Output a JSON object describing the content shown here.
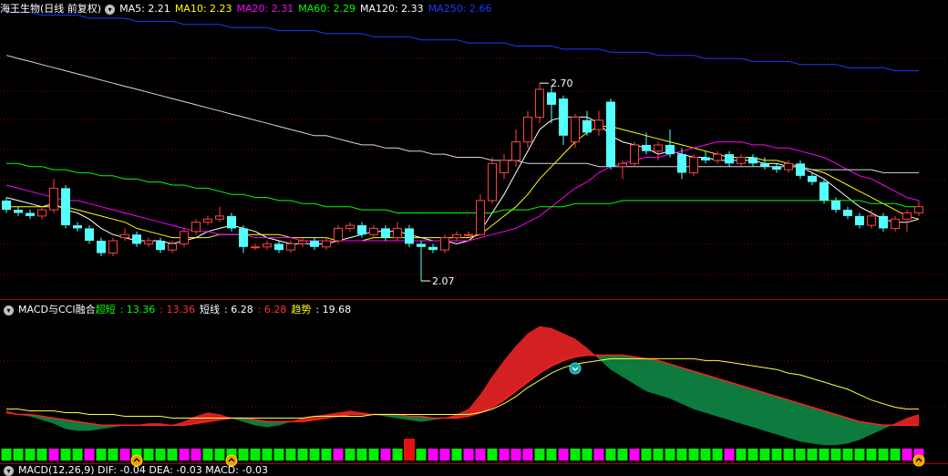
{
  "top_legend": {
    "title": "海王生物(日线 前复权)",
    "items": [
      {
        "label": "MA5: 2.21",
        "color": "#ffffff"
      },
      {
        "label": "MA10: 2.23",
        "color": "#ffff00"
      },
      {
        "label": "MA20: 2.31",
        "color": "#ff00ff"
      },
      {
        "label": "MA60: 2.29",
        "color": "#00ff00"
      },
      {
        "label": "MA120: 2.33",
        "color": "#ffffff"
      },
      {
        "label": "MA250: 2.66",
        "color": "#1e38ff"
      }
    ]
  },
  "price_annotations": {
    "high": "2.70",
    "low": "2.07"
  },
  "mid_legend": {
    "title": "MACD与CCI融合",
    "items": [
      {
        "label": "超短",
        "color": "#00ff00"
      },
      {
        "label": ": 13.36",
        "color": "#00ff00"
      },
      {
        "label": ": 13.36",
        "color": "#ff3030"
      },
      {
        "label": "短线",
        "color": "#ffffff"
      },
      {
        "label": ": 6.28",
        "color": "#ffffff"
      },
      {
        "label": ": 6.28",
        "color": "#ff3030"
      },
      {
        "label": "趋势",
        "color": "#ffff00"
      },
      {
        "label": ": 19.68",
        "color": "#ffffff"
      }
    ]
  },
  "bottom_legend": {
    "text": "MACD(12,26,9) DIF: -0.04 DEA: -0.03 MACD: -0.03"
  },
  "chart_data": {
    "type": "candlestick",
    "ylim": [
      2.02,
      2.92
    ],
    "candles": [
      [
        2.33,
        2.34,
        2.29,
        2.3
      ],
      [
        2.3,
        2.31,
        2.28,
        2.29
      ],
      [
        2.29,
        2.3,
        2.27,
        2.28
      ],
      [
        2.28,
        2.31,
        2.27,
        2.3
      ],
      [
        2.3,
        2.4,
        2.29,
        2.37
      ],
      [
        2.37,
        2.38,
        2.24,
        2.25
      ],
      [
        2.25,
        2.26,
        2.23,
        2.24
      ],
      [
        2.24,
        2.25,
        2.19,
        2.2
      ],
      [
        2.2,
        2.21,
        2.15,
        2.16
      ],
      [
        2.16,
        2.21,
        2.15,
        2.2
      ],
      [
        2.21,
        2.24,
        2.2,
        2.22
      ],
      [
        2.22,
        2.23,
        2.18,
        2.19
      ],
      [
        2.19,
        2.21,
        2.18,
        2.2
      ],
      [
        2.2,
        2.21,
        2.16,
        2.17
      ],
      [
        2.17,
        2.2,
        2.16,
        2.19
      ],
      [
        2.19,
        2.24,
        2.18,
        2.23
      ],
      [
        2.23,
        2.27,
        2.22,
        2.26
      ],
      [
        2.26,
        2.28,
        2.25,
        2.27
      ],
      [
        2.27,
        2.31,
        2.26,
        2.28
      ],
      [
        2.28,
        2.29,
        2.23,
        2.24
      ],
      [
        2.24,
        2.25,
        2.16,
        2.18
      ],
      [
        2.18,
        2.19,
        2.17,
        2.18
      ],
      [
        2.18,
        2.2,
        2.17,
        2.19
      ],
      [
        2.19,
        2.2,
        2.16,
        2.17
      ],
      [
        2.17,
        2.2,
        2.16,
        2.19
      ],
      [
        2.19,
        2.21,
        2.18,
        2.2
      ],
      [
        2.2,
        2.21,
        2.17,
        2.18
      ],
      [
        2.18,
        2.21,
        2.17,
        2.2
      ],
      [
        2.2,
        2.25,
        2.19,
        2.24
      ],
      [
        2.24,
        2.26,
        2.23,
        2.25
      ],
      [
        2.25,
        2.26,
        2.21,
        2.22
      ],
      [
        2.22,
        2.25,
        2.21,
        2.24
      ],
      [
        2.24,
        2.25,
        2.2,
        2.21
      ],
      [
        2.21,
        2.26,
        2.2,
        2.24
      ],
      [
        2.24,
        2.25,
        2.18,
        2.19
      ],
      [
        2.19,
        2.2,
        2.07,
        2.18
      ],
      [
        2.18,
        2.19,
        2.16,
        2.17
      ],
      [
        2.17,
        2.22,
        2.16,
        2.21
      ],
      [
        2.21,
        2.23,
        2.2,
        2.22
      ],
      [
        2.22,
        2.23,
        2.21,
        2.22
      ],
      [
        2.22,
        2.35,
        2.22,
        2.33
      ],
      [
        2.33,
        2.47,
        2.32,
        2.45
      ],
      [
        2.42,
        2.48,
        2.4,
        2.46
      ],
      [
        2.46,
        2.56,
        2.44,
        2.52
      ],
      [
        2.52,
        2.62,
        2.5,
        2.6
      ],
      [
        2.6,
        2.71,
        2.58,
        2.69
      ],
      [
        2.68,
        2.7,
        2.58,
        2.64
      ],
      [
        2.66,
        2.67,
        2.51,
        2.54
      ],
      [
        2.52,
        2.61,
        2.5,
        2.6
      ],
      [
        2.59,
        2.62,
        2.54,
        2.55
      ],
      [
        2.56,
        2.62,
        2.54,
        2.59
      ],
      [
        2.65,
        2.66,
        2.43,
        2.44
      ],
      [
        2.44,
        2.46,
        2.4,
        2.45
      ],
      [
        2.45,
        2.52,
        2.44,
        2.51
      ],
      [
        2.51,
        2.55,
        2.48,
        2.49
      ],
      [
        2.49,
        2.52,
        2.46,
        2.51
      ],
      [
        2.51,
        2.56,
        2.47,
        2.48
      ],
      [
        2.48,
        2.5,
        2.4,
        2.42
      ],
      [
        2.42,
        2.48,
        2.41,
        2.47
      ],
      [
        2.47,
        2.49,
        2.45,
        2.46
      ],
      [
        2.46,
        2.49,
        2.45,
        2.48
      ],
      [
        2.48,
        2.49,
        2.44,
        2.45
      ],
      [
        2.45,
        2.48,
        2.44,
        2.47
      ],
      [
        2.47,
        2.48,
        2.44,
        2.45
      ],
      [
        2.45,
        2.47,
        2.43,
        2.44
      ],
      [
        2.44,
        2.45,
        2.42,
        2.43
      ],
      [
        2.43,
        2.46,
        2.42,
        2.45
      ],
      [
        2.45,
        2.46,
        2.4,
        2.41
      ],
      [
        2.41,
        2.42,
        2.38,
        2.39
      ],
      [
        2.39,
        2.4,
        2.32,
        2.33
      ],
      [
        2.33,
        2.34,
        2.29,
        2.3
      ],
      [
        2.3,
        2.31,
        2.27,
        2.28
      ],
      [
        2.28,
        2.29,
        2.24,
        2.25
      ],
      [
        2.25,
        2.3,
        2.24,
        2.28
      ],
      [
        2.28,
        2.29,
        2.23,
        2.24
      ],
      [
        2.24,
        2.28,
        2.23,
        2.27
      ],
      [
        2.27,
        2.3,
        2.23,
        2.29
      ],
      [
        2.29,
        2.33,
        2.28,
        2.31
      ]
    ],
    "ma": [
      {
        "name": "MA5",
        "color": "#ffffff",
        "values": [
          2.34,
          2.33,
          2.32,
          2.31,
          2.32,
          2.3,
          2.29,
          2.27,
          2.24,
          2.22,
          2.21,
          2.2,
          2.2,
          2.2,
          2.19,
          2.2,
          2.21,
          2.23,
          2.24,
          2.25,
          2.24,
          2.23,
          2.21,
          2.2,
          2.19,
          2.19,
          2.19,
          2.19,
          2.2,
          2.21,
          2.22,
          2.23,
          2.23,
          2.23,
          2.22,
          2.21,
          2.2,
          2.2,
          2.19,
          2.2,
          2.23,
          2.29,
          2.35,
          2.42,
          2.49,
          2.56,
          2.59,
          2.6,
          2.6,
          2.6,
          2.58,
          2.54,
          2.52,
          2.51,
          2.5,
          2.48,
          2.49,
          2.48,
          2.47,
          2.47,
          2.46,
          2.46,
          2.46,
          2.46,
          2.45,
          2.45,
          2.44,
          2.44,
          2.42,
          2.4,
          2.37,
          2.34,
          2.31,
          2.29,
          2.27,
          2.26,
          2.26,
          2.27
        ]
      },
      {
        "name": "MA10",
        "color": "#ffff00",
        "values": [
          2.31,
          2.31,
          2.31,
          2.31,
          2.31,
          2.31,
          2.3,
          2.29,
          2.28,
          2.27,
          2.26,
          2.24,
          2.23,
          2.22,
          2.21,
          2.21,
          2.21,
          2.21,
          2.22,
          2.22,
          2.22,
          2.22,
          2.22,
          2.22,
          2.21,
          2.21,
          2.21,
          2.21,
          2.2,
          2.2,
          2.2,
          2.21,
          2.21,
          2.21,
          2.21,
          2.21,
          2.21,
          2.21,
          2.21,
          2.21,
          2.22,
          2.25,
          2.28,
          2.31,
          2.35,
          2.4,
          2.44,
          2.48,
          2.52,
          2.55,
          2.57,
          2.57,
          2.56,
          2.55,
          2.54,
          2.53,
          2.52,
          2.51,
          2.5,
          2.49,
          2.48,
          2.47,
          2.47,
          2.47,
          2.46,
          2.46,
          2.45,
          2.44,
          2.43,
          2.42,
          2.4,
          2.38,
          2.36,
          2.34,
          2.32,
          2.3,
          2.28,
          2.27
        ]
      },
      {
        "name": "MA20",
        "color": "#ff00ff",
        "values": [
          2.38,
          2.37,
          2.36,
          2.35,
          2.34,
          2.33,
          2.33,
          2.32,
          2.31,
          2.3,
          2.29,
          2.28,
          2.27,
          2.26,
          2.25,
          2.24,
          2.23,
          2.23,
          2.22,
          2.22,
          2.22,
          2.21,
          2.21,
          2.21,
          2.21,
          2.2,
          2.2,
          2.2,
          2.2,
          2.2,
          2.2,
          2.2,
          2.2,
          2.2,
          2.2,
          2.2,
          2.2,
          2.2,
          2.2,
          2.2,
          2.21,
          2.22,
          2.23,
          2.24,
          2.26,
          2.28,
          2.31,
          2.34,
          2.37,
          2.39,
          2.42,
          2.44,
          2.45,
          2.46,
          2.47,
          2.47,
          2.48,
          2.49,
          2.5,
          2.51,
          2.52,
          2.52,
          2.52,
          2.51,
          2.51,
          2.5,
          2.5,
          2.49,
          2.48,
          2.47,
          2.45,
          2.43,
          2.41,
          2.4,
          2.38,
          2.36,
          2.34,
          2.33
        ]
      },
      {
        "name": "MA60",
        "color": "#00ff00",
        "values": [
          2.45,
          2.45,
          2.44,
          2.44,
          2.43,
          2.43,
          2.42,
          2.42,
          2.41,
          2.41,
          2.4,
          2.4,
          2.39,
          2.39,
          2.38,
          2.38,
          2.37,
          2.37,
          2.36,
          2.35,
          2.35,
          2.34,
          2.34,
          2.33,
          2.33,
          2.32,
          2.32,
          2.31,
          2.31,
          2.31,
          2.3,
          2.3,
          2.3,
          2.29,
          2.29,
          2.29,
          2.29,
          2.29,
          2.29,
          2.29,
          2.29,
          2.29,
          2.3,
          2.3,
          2.3,
          2.31,
          2.31,
          2.31,
          2.32,
          2.32,
          2.32,
          2.32,
          2.33,
          2.33,
          2.33,
          2.33,
          2.33,
          2.33,
          2.33,
          2.33,
          2.33,
          2.33,
          2.33,
          2.33,
          2.33,
          2.33,
          2.33,
          2.33,
          2.33,
          2.33,
          2.33,
          2.33,
          2.33,
          2.32,
          2.32,
          2.32,
          2.31,
          2.31
        ]
      },
      {
        "name": "MA120",
        "color": "#d8d8d8",
        "values": [
          2.8,
          2.79,
          2.78,
          2.77,
          2.76,
          2.75,
          2.74,
          2.73,
          2.72,
          2.71,
          2.7,
          2.69,
          2.68,
          2.67,
          2.66,
          2.65,
          2.64,
          2.63,
          2.62,
          2.61,
          2.6,
          2.59,
          2.58,
          2.57,
          2.56,
          2.55,
          2.54,
          2.54,
          2.53,
          2.52,
          2.51,
          2.51,
          2.5,
          2.5,
          2.49,
          2.49,
          2.48,
          2.48,
          2.47,
          2.47,
          2.47,
          2.46,
          2.46,
          2.46,
          2.45,
          2.45,
          2.45,
          2.45,
          2.45,
          2.45,
          2.44,
          2.44,
          2.44,
          2.44,
          2.44,
          2.44,
          2.44,
          2.44,
          2.44,
          2.44,
          2.44,
          2.44,
          2.44,
          2.44,
          2.44,
          2.44,
          2.44,
          2.44,
          2.43,
          2.43,
          2.43,
          2.43,
          2.43,
          2.43,
          2.42,
          2.42,
          2.42,
          2.42
        ]
      },
      {
        "name": "MA250",
        "color": "#1e38ff",
        "values": [
          2.94,
          2.94,
          2.94,
          2.93,
          2.93,
          2.93,
          2.93,
          2.92,
          2.92,
          2.92,
          2.92,
          2.91,
          2.91,
          2.91,
          2.91,
          2.9,
          2.9,
          2.9,
          2.9,
          2.89,
          2.89,
          2.89,
          2.89,
          2.88,
          2.88,
          2.88,
          2.88,
          2.87,
          2.87,
          2.87,
          2.87,
          2.86,
          2.86,
          2.86,
          2.86,
          2.85,
          2.85,
          2.85,
          2.85,
          2.84,
          2.84,
          2.84,
          2.84,
          2.83,
          2.83,
          2.83,
          2.83,
          2.82,
          2.82,
          2.82,
          2.82,
          2.81,
          2.81,
          2.81,
          2.81,
          2.8,
          2.8,
          2.8,
          2.8,
          2.79,
          2.79,
          2.79,
          2.79,
          2.78,
          2.78,
          2.78,
          2.78,
          2.77,
          2.77,
          2.77,
          2.77,
          2.76,
          2.76,
          2.76,
          2.76,
          2.75,
          2.75,
          2.75
        ]
      }
    ],
    "indicator": {
      "ylim": [
        -15,
        55
      ],
      "fast": [
        5,
        3,
        2,
        0,
        -2,
        -5,
        -6,
        -6,
        -5,
        -4,
        -3,
        -3,
        -2,
        -2,
        -3,
        -1,
        2,
        4,
        3,
        1,
        -1,
        -3,
        -4,
        -3,
        -1,
        1,
        2,
        3,
        4,
        5,
        4,
        3,
        2,
        1,
        0,
        -1,
        0,
        1,
        3,
        6,
        14,
        24,
        33,
        41,
        48,
        52,
        51,
        48,
        45,
        40,
        34,
        28,
        24,
        20,
        16,
        14,
        12,
        9,
        6,
        4,
        2,
        0,
        -2,
        -4,
        -6,
        -8,
        -10,
        -12,
        -13,
        -14,
        -14,
        -13,
        -11,
        -8,
        -5,
        -2,
        1,
        3
      ],
      "slow": [
        4,
        3,
        3,
        2,
        1,
        0,
        -1,
        -2,
        -3,
        -3,
        -3,
        -3,
        -3,
        -3,
        -3,
        -3,
        -2,
        -1,
        0,
        1,
        1,
        0,
        -1,
        -1,
        -1,
        -1,
        0,
        1,
        2,
        3,
        3,
        3,
        3,
        3,
        2,
        2,
        1,
        1,
        1,
        2,
        4,
        7,
        11,
        16,
        21,
        26,
        30,
        33,
        35,
        36,
        36,
        36,
        36,
        35,
        34,
        33,
        31,
        29,
        27,
        25,
        23,
        21,
        19,
        17,
        15,
        13,
        11,
        9,
        7,
        5,
        3,
        1,
        -1,
        -2,
        -3,
        -3,
        -3,
        -3
      ],
      "trend": [
        6,
        6,
        5,
        5,
        5,
        4,
        4,
        3,
        3,
        3,
        2,
        2,
        2,
        2,
        1,
        1,
        1,
        1,
        1,
        1,
        1,
        1,
        1,
        1,
        1,
        1,
        2,
        2,
        2,
        2,
        2,
        3,
        3,
        3,
        3,
        3,
        3,
        3,
        3,
        3,
        4,
        6,
        9,
        13,
        18,
        22,
        26,
        29,
        31,
        32,
        33,
        34,
        34,
        34,
        34,
        34,
        34,
        34,
        34,
        33,
        33,
        32,
        31,
        30,
        29,
        28,
        26,
        25,
        23,
        21,
        19,
        17,
        14,
        11,
        9,
        7,
        6,
        6
      ],
      "bar_colors": [
        "g",
        "g",
        "g",
        "g",
        "m",
        "g",
        "g",
        "m",
        "g",
        "g",
        "m",
        "g",
        "g",
        "g",
        "g",
        "m",
        "m",
        "g",
        "g",
        "g",
        "g",
        "g",
        "g",
        "g",
        "g",
        "g",
        "g",
        "g",
        "m",
        "g",
        "g",
        "g",
        "m",
        "g",
        "g",
        "g",
        "m",
        "m",
        "g",
        "m",
        "m",
        "g",
        "m",
        "m",
        "m",
        "g",
        "g",
        "m",
        "g",
        "g",
        "m",
        "g",
        "g",
        "m",
        "g",
        "g",
        "g",
        "g",
        "g",
        "g",
        "g",
        "m",
        "g",
        "g",
        "g",
        "g",
        "g",
        "g",
        "g",
        "g",
        "g",
        "g",
        "g",
        "g",
        "g",
        "g",
        "m",
        "m"
      ],
      "signals_up": [
        11,
        19,
        77
      ],
      "signal_down": 35
    }
  }
}
